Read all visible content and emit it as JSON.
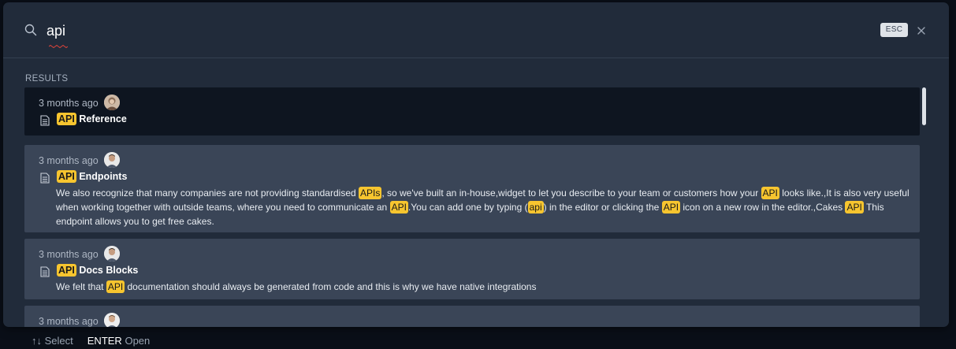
{
  "search": {
    "value": "api",
    "esc_label": "ESC"
  },
  "results_label": "RESULTS",
  "results": [
    {
      "time": "3 months ago",
      "title_highlight": "API",
      "title_rest": " Reference",
      "description": []
    },
    {
      "time": "3 months ago",
      "title_highlight": "API",
      "title_rest": " Endpoints",
      "description": [
        {
          "t": "We also recognize that many companies are not providing standardised "
        },
        {
          "t": "APIs",
          "h": true
        },
        {
          "t": ", so we've built an in-house,widget to let you describe to your team or customers how your "
        },
        {
          "t": "API",
          "h": true
        },
        {
          "t": " looks like.,It is also very useful when working together with outside teams, where you need to communicate an "
        },
        {
          "t": "API",
          "h": true
        },
        {
          "t": ".You can add one by typing ("
        },
        {
          "t": "api",
          "h": true
        },
        {
          "t": ") in the editor or clicking the "
        },
        {
          "t": "API",
          "h": true
        },
        {
          "t": " icon on a new row in the editor.,Cakes "
        },
        {
          "t": "API",
          "h": true
        },
        {
          "t": " This endpoint allows you to get free cakes."
        }
      ]
    },
    {
      "time": "3 months ago",
      "title_highlight": "API",
      "title_rest": " Docs Blocks",
      "description": [
        {
          "t": "We felt that "
        },
        {
          "t": "API",
          "h": true
        },
        {
          "t": " documentation should always be generated from code and this is why we have native integrations"
        }
      ]
    },
    {
      "time": "3 months ago",
      "title_highlight": "",
      "title_rest": "",
      "description": []
    }
  ],
  "footer": {
    "arrows": "↑↓",
    "select_label": "Select",
    "enter_key": "ENTER",
    "open_label": "Open"
  },
  "colors": {
    "highlight": "#f7c52f",
    "modal_bg": "#212b3a",
    "result_bg": "#3a4557",
    "active_result_bg": "#0e1520"
  }
}
